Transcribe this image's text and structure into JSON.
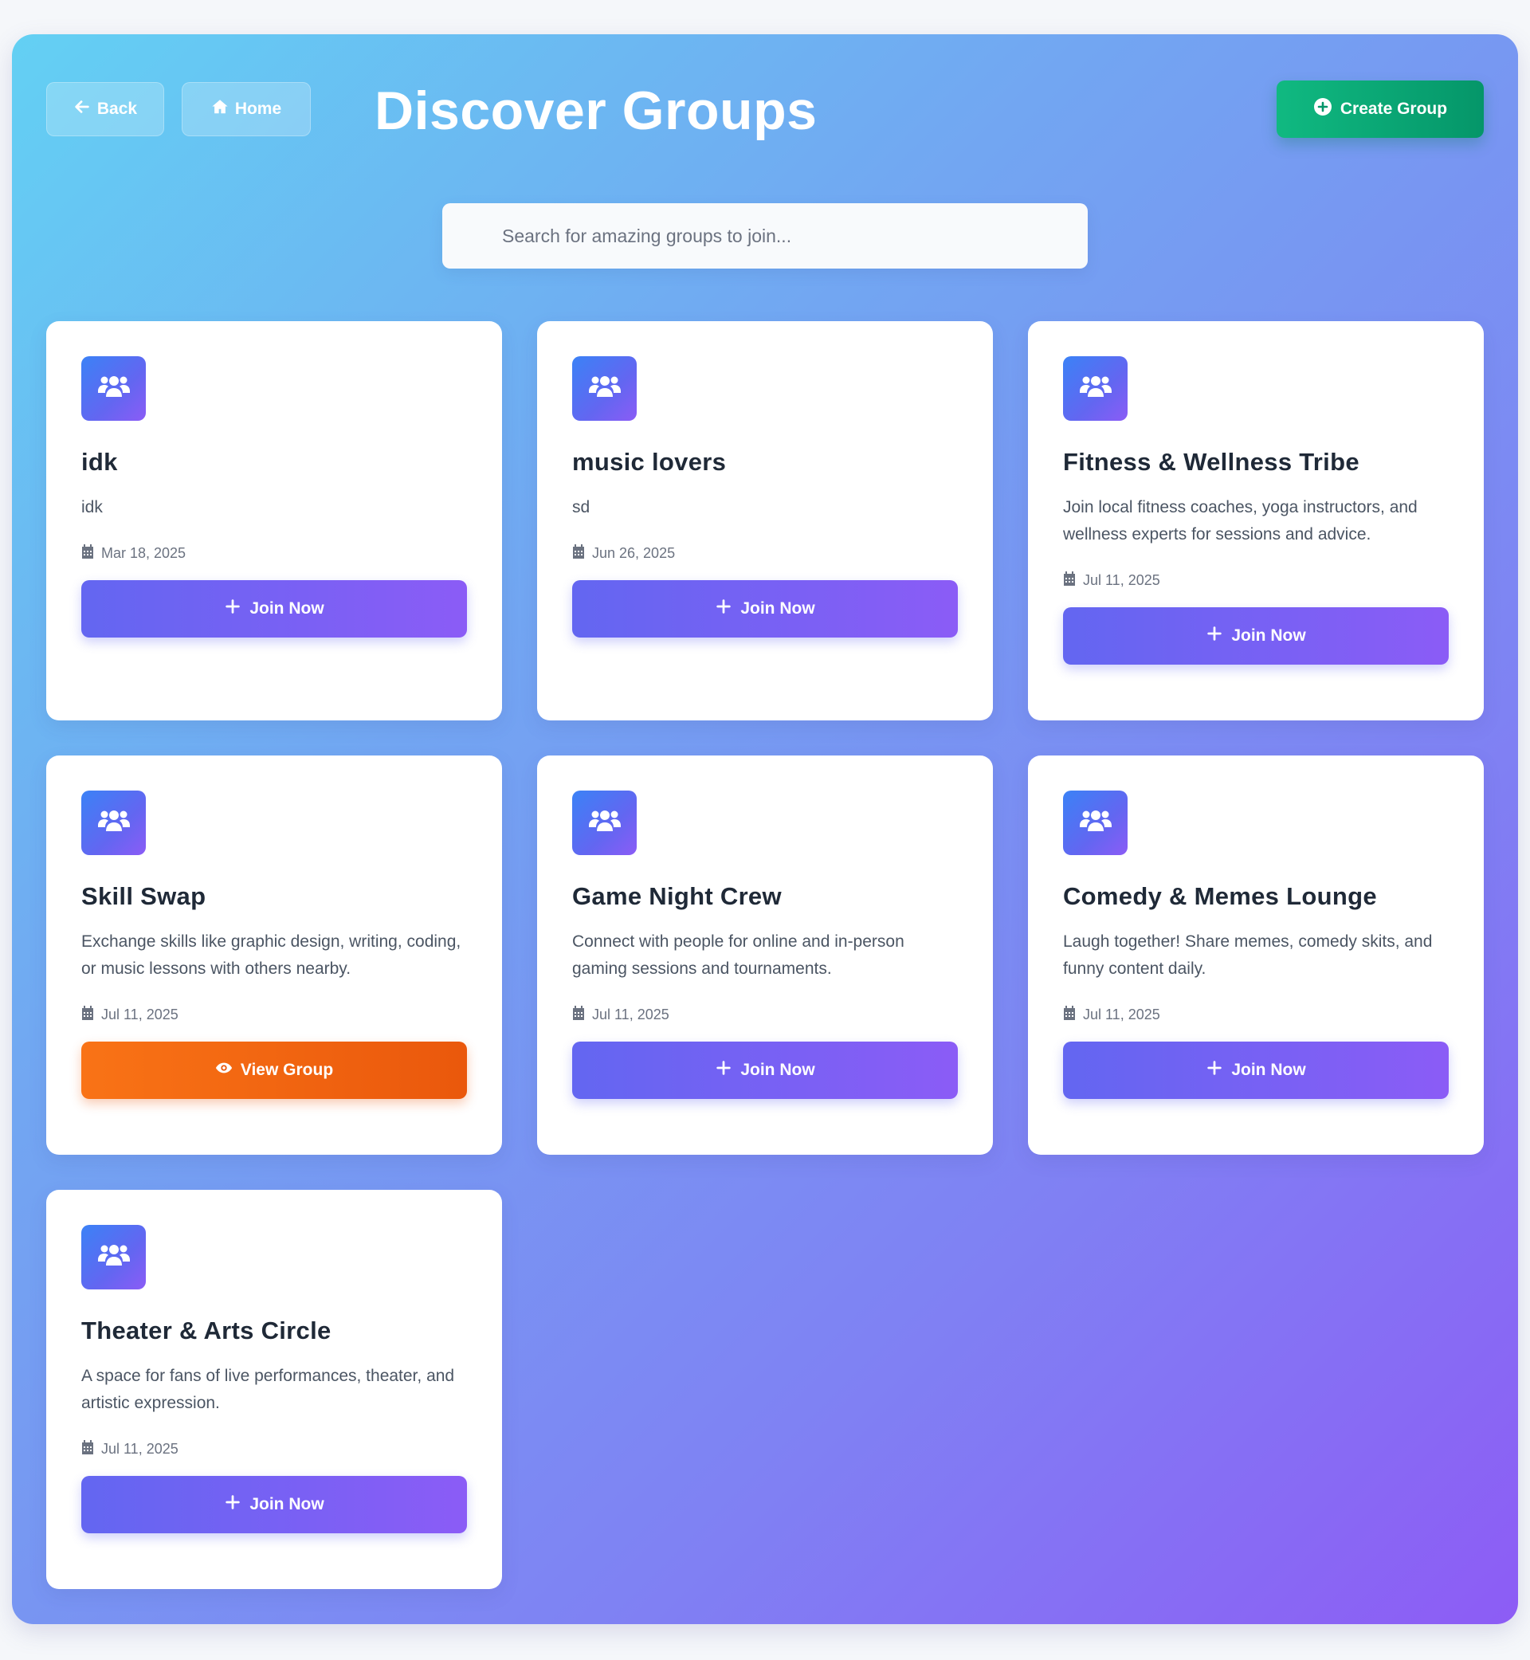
{
  "header": {
    "back_label": "Back",
    "home_label": "Home",
    "title": "Discover Groups",
    "create_label": "Create Group"
  },
  "search": {
    "placeholder": "Search for amazing groups to join...",
    "value": ""
  },
  "colors": {
    "join_button": "#6366f1",
    "view_button": "#f97316",
    "create_button": "#10b981"
  },
  "groups": [
    {
      "title": "idk",
      "description": "idk",
      "date": "Mar 18, 2025",
      "action": "Join Now",
      "action_type": "join"
    },
    {
      "title": "music lovers",
      "description": "sd",
      "date": "Jun 26, 2025",
      "action": "Join Now",
      "action_type": "join"
    },
    {
      "title": "Fitness & Wellness Tribe",
      "description": "Join local fitness coaches, yoga instructors, and wellness experts for sessions and advice.",
      "date": "Jul 11, 2025",
      "action": "Join Now",
      "action_type": "join"
    },
    {
      "title": "Skill Swap",
      "description": "Exchange skills like graphic design, writing, coding, or music lessons with others nearby.",
      "date": "Jul 11, 2025",
      "action": "View Group",
      "action_type": "view"
    },
    {
      "title": "Game Night Crew",
      "description": "Connect with people for online and in-person gaming sessions and tournaments.",
      "date": "Jul 11, 2025",
      "action": "Join Now",
      "action_type": "join"
    },
    {
      "title": "Comedy & Memes Lounge",
      "description": "Laugh together! Share memes, comedy skits, and funny content daily.",
      "date": "Jul 11, 2025",
      "action": "Join Now",
      "action_type": "join"
    },
    {
      "title": "Theater & Arts Circle",
      "description": "A space for fans of live performances, theater, and artistic expression.",
      "date": "Jul 11, 2025",
      "action": "Join Now",
      "action_type": "join"
    }
  ]
}
